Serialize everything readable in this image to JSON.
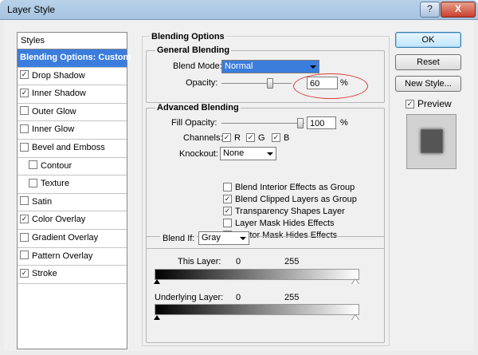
{
  "window": {
    "title": "Layer Style",
    "help_label": "?",
    "close_label": "X"
  },
  "styles_list": {
    "header": "Styles",
    "items": [
      {
        "label": "Blending Options: Custom",
        "checkbox": false,
        "checked": false,
        "selected": true,
        "indent": false
      },
      {
        "label": "Drop Shadow",
        "checkbox": true,
        "checked": true,
        "selected": false,
        "indent": false
      },
      {
        "label": "Inner Shadow",
        "checkbox": true,
        "checked": true,
        "selected": false,
        "indent": false
      },
      {
        "label": "Outer Glow",
        "checkbox": true,
        "checked": false,
        "selected": false,
        "indent": false
      },
      {
        "label": "Inner Glow",
        "checkbox": true,
        "checked": false,
        "selected": false,
        "indent": false
      },
      {
        "label": "Bevel and Emboss",
        "checkbox": true,
        "checked": false,
        "selected": false,
        "indent": false
      },
      {
        "label": "Contour",
        "checkbox": true,
        "checked": false,
        "selected": false,
        "indent": true
      },
      {
        "label": "Texture",
        "checkbox": true,
        "checked": false,
        "selected": false,
        "indent": true
      },
      {
        "label": "Satin",
        "checkbox": true,
        "checked": false,
        "selected": false,
        "indent": false
      },
      {
        "label": "Color Overlay",
        "checkbox": true,
        "checked": true,
        "selected": false,
        "indent": false
      },
      {
        "label": "Gradient Overlay",
        "checkbox": true,
        "checked": false,
        "selected": false,
        "indent": false
      },
      {
        "label": "Pattern Overlay",
        "checkbox": true,
        "checked": false,
        "selected": false,
        "indent": false
      },
      {
        "label": "Stroke",
        "checkbox": true,
        "checked": true,
        "selected": false,
        "indent": false
      }
    ]
  },
  "blending": {
    "title": "Blending Options",
    "general": {
      "title": "General Blending",
      "blend_mode_label": "Blend Mode:",
      "blend_mode_value": "Normal",
      "opacity_label": "Opacity:",
      "opacity_value": "60",
      "percent": "%"
    },
    "advanced": {
      "title": "Advanced Blending",
      "fill_opacity_label": "Fill Opacity:",
      "fill_opacity_value": "100",
      "percent": "%",
      "channels_label": "Channels:",
      "channel_r": "R",
      "channel_g": "G",
      "channel_b": "B",
      "knockout_label": "Knockout:",
      "knockout_value": "None",
      "options": [
        {
          "label": "Blend Interior Effects as Group",
          "checked": false
        },
        {
          "label": "Blend Clipped Layers as Group",
          "checked": true
        },
        {
          "label": "Transparency Shapes Layer",
          "checked": true
        },
        {
          "label": "Layer Mask Hides Effects",
          "checked": false
        },
        {
          "label": "Vector Mask Hides Effects",
          "checked": false
        }
      ]
    },
    "blend_if": {
      "label": "Blend If:",
      "value": "Gray",
      "this_layer_label": "This Layer:",
      "this_layer_min": "0",
      "this_layer_max": "255",
      "underlying_label": "Underlying Layer:",
      "underlying_min": "0",
      "underlying_max": "255"
    }
  },
  "buttons": {
    "ok": "OK",
    "reset": "Reset",
    "new_style": "New Style...",
    "preview_label": "Preview",
    "preview_checked": true
  },
  "colors": {
    "selection": "#3b7ddd",
    "annotation": "#e03a3a",
    "title_bar": "#b9d2ea"
  }
}
